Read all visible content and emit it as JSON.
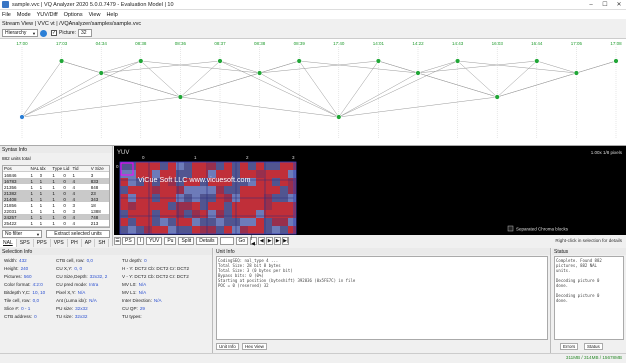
{
  "window": {
    "title": "sample.vvc | VQ Analyzer 2020 5.0.0.7479 - Evaluation Model | 10"
  },
  "menu": [
    "File",
    "Mode",
    "YUV/Diff",
    "Options",
    "View",
    "Help"
  ],
  "stream_view": {
    "label": "Stream View | VVC vt | /VQAnalyzer/samples/sample.vvc"
  },
  "toolbar": {
    "mode": "Hierarchy",
    "picture_label": "Picture:",
    "picture_value": "32"
  },
  "graph": {
    "times": [
      "17:00",
      "17:03",
      "04:34",
      "08:38",
      "08:36",
      "08:37",
      "08:38",
      "08:39",
      "17:40",
      "14:01",
      "14:22",
      "14:43",
      "16:03",
      "16:44",
      "17:05",
      "17:08"
    ],
    "node_color": "#21a637",
    "edge_color": "#9a9a9a",
    "highlight_color": "#2b7fd6"
  },
  "syntax": {
    "header": "Syntax Info",
    "count": "882 units total",
    "columns": [
      "Pos",
      "NAL",
      "Idx",
      "Type",
      "Lid",
      "Tid",
      "V Size"
    ],
    "rows": [
      [
        "16846",
        "1",
        "0",
        "1",
        "0",
        "1",
        "3"
      ],
      [
        "16783",
        "1",
        "1",
        "1",
        "0",
        "4",
        "833"
      ],
      [
        "21356",
        "1",
        "1",
        "1",
        "0",
        "4",
        "848"
      ],
      [
        "21382",
        "1",
        "1",
        "1",
        "0",
        "4",
        "23"
      ],
      [
        "21408",
        "1",
        "1",
        "1",
        "0",
        "4",
        "343"
      ],
      [
        "21856",
        "1",
        "1",
        "1",
        "0",
        "3",
        "18"
      ],
      [
        "22031",
        "1",
        "1",
        "1",
        "0",
        "3",
        "1388"
      ],
      [
        "24257",
        "1",
        "1",
        "1",
        "0",
        "4",
        "748"
      ],
      [
        "25422",
        "1",
        "1",
        "1",
        "0",
        "4",
        "213"
      ],
      [
        "26288",
        "1",
        "1",
        "1",
        "0",
        "4",
        "288"
      ]
    ],
    "selected_rows": [
      1,
      3,
      4,
      7,
      9
    ],
    "filter": "No filter",
    "extract_button": "Extract selected units",
    "tabs": [
      "NAL",
      "SPS",
      "PPS",
      "VPS",
      "PH",
      "AP",
      "SH"
    ]
  },
  "yuv": {
    "label": "YUV",
    "watermark": "ViCue Soft LLC  www.vicuesoft.com",
    "zoom_info": "1.00x 1/8 pixels",
    "col_marks": [
      "0",
      "1",
      "2",
      "3"
    ],
    "separated_chroma": "Separated Chroma blocks",
    "hint": "Right-click in selection for details",
    "toolbar": {
      "ps": "PS",
      "i": "I",
      "yuv": "YUV",
      "pu": "Pu",
      "split": "Split",
      "details": "Details",
      "go": "Go"
    }
  },
  "selection": {
    "header": "Selection Info",
    "left": [
      [
        "Width:",
        "432"
      ],
      [
        "Height:",
        "240"
      ],
      [
        "Pictures:",
        "560"
      ],
      [
        "Color format:",
        "4:2:0"
      ],
      [
        "Bitdepth Y,C:",
        "10, 10"
      ],
      [
        "Tile cell, row:",
        "0,0"
      ],
      [
        "Slice #:",
        "0 - 1"
      ],
      [
        "CTB address:",
        "0"
      ]
    ],
    "mid": [
      [
        "CTB cell, row:",
        "0,0"
      ],
      [
        "CU X,Y:",
        "0, 0"
      ],
      [
        "CU Size,Depth:",
        "32x32, 2"
      ],
      [
        "CU pred mode:",
        "Intra"
      ],
      [
        "Pixel X,Y:",
        "N/A"
      ],
      [
        "Ant (Luma idx):",
        "N/A"
      ],
      [
        "PU size:",
        "32x32"
      ],
      [
        "TU size:",
        "32x32"
      ]
    ],
    "right": [
      [
        "TU depth:",
        "0"
      ],
      [
        "H - Y: DCT2  Cb: DCT2  Cr: DCT2",
        ""
      ],
      [
        "V - Y: DCT2  Cb: DCT2  Cr: DCT2",
        ""
      ],
      [
        "MV L0:",
        "N/A"
      ],
      [
        "MV L1:",
        "N/A"
      ],
      [
        "Inter Direction:",
        "N/A"
      ],
      [
        "CU QP:",
        "29"
      ]
    ],
    "tu_types": [
      "TU types:"
    ]
  },
  "unit": {
    "header": "Unit Info",
    "lines": [
      "CodingSEQ: nal_type 4 ...",
      "Total Size: 28 bit 8 bytes",
      "Total Size: 3 (0 bytes per bit)",
      "Bypass bits: 0 (0%)",
      "Starting at position (byteshift) 392836 (0x5FE7C) in file",
      "POC = 0  (reserved) 32"
    ],
    "tabs": [
      "Unit Info",
      "Hex View"
    ]
  },
  "status": {
    "header": "Status",
    "lines": [
      "Complete. Found 882",
      "pictures, 882 NAL",
      "units.",
      "",
      "Decoding picture 0",
      "done.",
      "",
      "Decoding picture 0",
      "done."
    ],
    "tabs": [
      "Errors",
      "Status"
    ]
  },
  "statusbar": {
    "memory": "311MB / 314MB / 15678MB"
  }
}
